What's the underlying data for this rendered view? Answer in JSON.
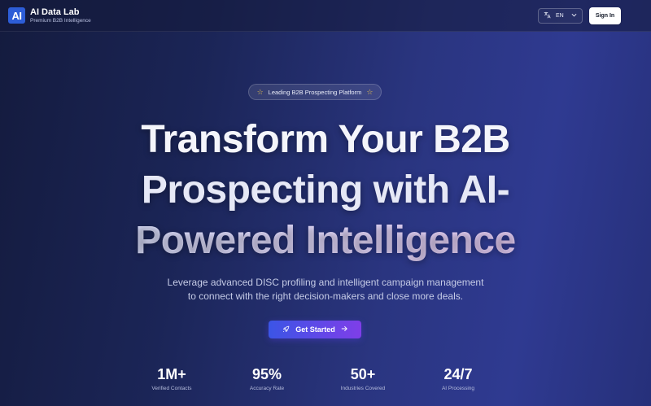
{
  "header": {
    "logo_text": "AI",
    "brand_title": "AI Data Lab",
    "brand_subtitle": "Premium B2B Intelligence",
    "language": "EN",
    "translate_icon": "translate-icon",
    "chevron_icon": "chevron-down-icon",
    "signin_label": "Sign In"
  },
  "hero": {
    "badge_text": "Leading B2B Prospecting Platform",
    "title_line1": "Transform Your B2B",
    "title_line2": "Prospecting with AI-",
    "title_line3": "Powered Intelligence",
    "subtitle_line1": "Leverage advanced DISC profiling and intelligent campaign management",
    "subtitle_line2": "to connect with the right decision-makers and close more deals.",
    "cta_label": "Get Started"
  },
  "stats": [
    {
      "value": "1M+",
      "label": "Verified Contacts"
    },
    {
      "value": "95%",
      "label": "Accuracy Rate"
    },
    {
      "value": "50+",
      "label": "Industries Covered"
    },
    {
      "value": "24/7",
      "label": "AI Processing"
    }
  ],
  "colors": {
    "accent_start": "#3b55e6",
    "accent_end": "#7f3ee8",
    "logo_bg": "#2d5dd7",
    "star": "#f2c94c"
  }
}
